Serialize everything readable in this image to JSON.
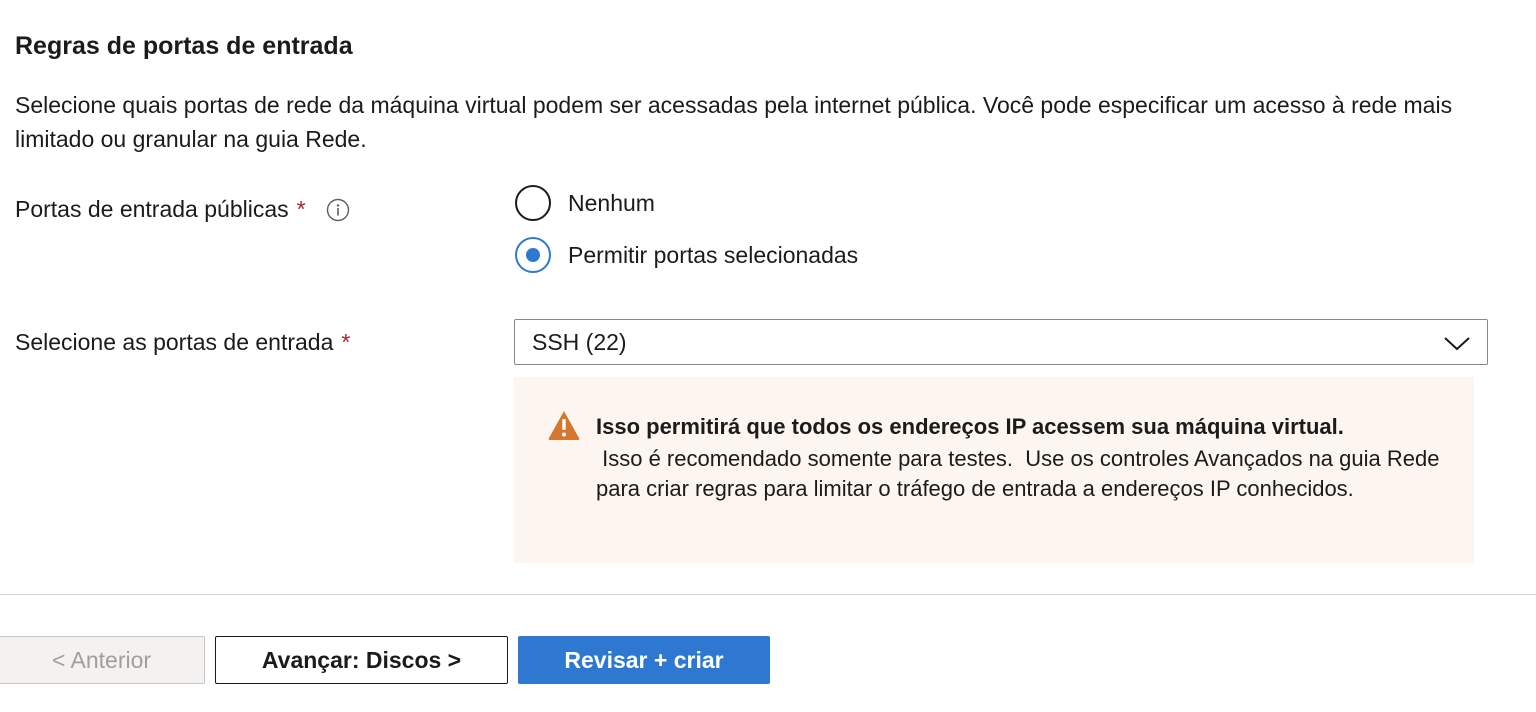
{
  "section": {
    "title": "Regras de portas de entrada",
    "description": "Selecione quais portas de rede da máquina virtual podem ser acessadas pela internet pública. Você pode especificar um acesso à rede mais limitado ou granular na guia Rede."
  },
  "public_ports": {
    "label": "Portas de entrada públicas",
    "required_mark": "*",
    "options": [
      {
        "label": "Nenhum",
        "selected": false
      },
      {
        "label": "Permitir portas selecionadas",
        "selected": true
      }
    ]
  },
  "inbound_ports": {
    "label": "Selecione as portas de entrada",
    "required_mark": "*",
    "selected_value": "SSH (22)"
  },
  "warning": {
    "title": "Isso permitirá que todos os endereços IP acessem sua máquina virtual.",
    "body": " Isso é recomendado somente para testes.  Use os controles Avançados na guia Rede para criar regras para limitar o tráfego de entrada a endereços IP conhecidos."
  },
  "footer": {
    "prev_label": "< Anterior",
    "next_label": "Avançar: Discos >",
    "review_label": "Revisar + criar"
  },
  "colors": {
    "accent": "#2e78d2",
    "required": "#a4262c",
    "warning_bg": "#fdf6f0",
    "warning_icon": "#d67730"
  },
  "icons": {
    "info": "info-icon",
    "dropdown": "chevron-down-icon",
    "warning": "warning-icon"
  }
}
